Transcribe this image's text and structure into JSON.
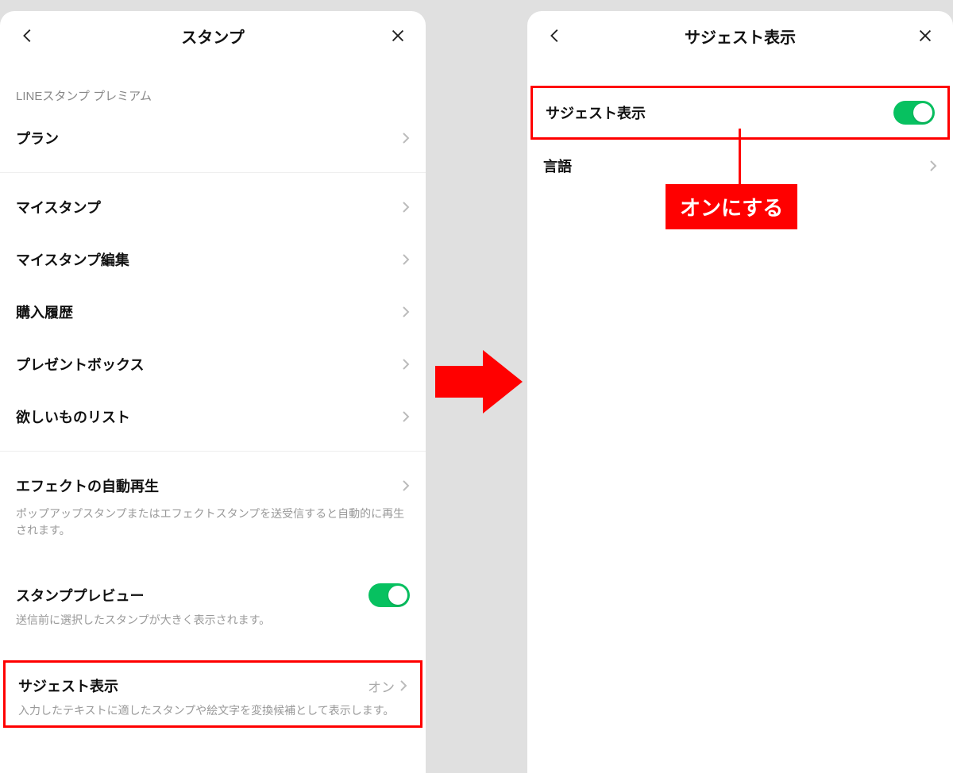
{
  "left": {
    "header_title": "スタンプ",
    "section_header": "LINEスタンプ プレミアム",
    "rows": {
      "plan": "プラン",
      "my_stamp": "マイスタンプ",
      "my_stamp_edit": "マイスタンプ編集",
      "purchase_history": "購入履歴",
      "present_box": "プレゼントボックス",
      "wishlist": "欲しいものリスト",
      "auto_play": "エフェクトの自動再生",
      "auto_play_desc": "ポップアップスタンプまたはエフェクトスタンプを送受信すると自動的に再生されます。",
      "stamp_preview": "スタンププレビュー",
      "stamp_preview_desc": "送信前に選択したスタンプが大きく表示されます。",
      "suggest": "サジェスト表示",
      "suggest_status": "オン",
      "suggest_desc": "入力したテキストに適したスタンプや絵文字を変換候補として表示します。"
    }
  },
  "right": {
    "header_title": "サジェスト表示",
    "rows": {
      "suggest": "サジェスト表示",
      "language": "言語"
    }
  },
  "annotation": {
    "callout": "オンにする"
  },
  "colors": {
    "accent_green": "#07c160",
    "highlight_red": "#ff0000"
  }
}
